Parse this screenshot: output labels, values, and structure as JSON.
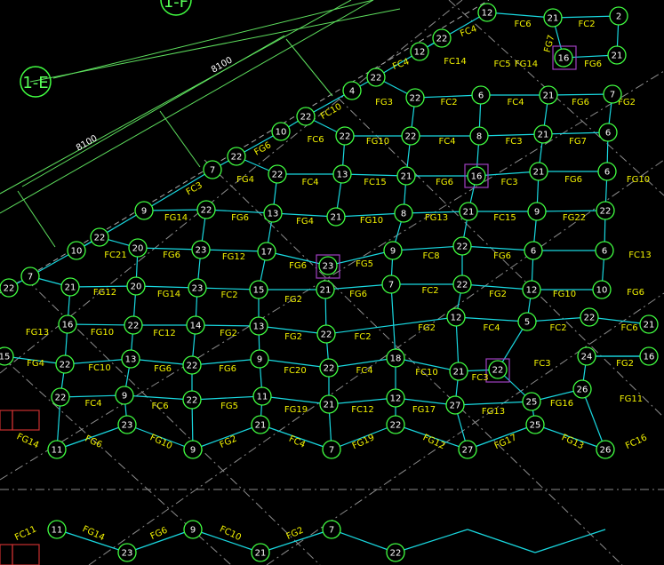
{
  "axis_labels": {
    "axis_e": "1-E",
    "axis_f": "1-F"
  },
  "dimensions": {
    "upper": "8100",
    "lower": "8100"
  },
  "colors": {
    "background": "#000000",
    "node_ring": "#41ff41",
    "beam": "#19d8e0",
    "label": "#f2f200",
    "dimension": "#5ee05e",
    "axis_dash": "#8c8c8c",
    "column_box": "#a040c0",
    "slab_box": "#c83030"
  },
  "nodes": [
    "12",
    "21",
    "2",
    "16",
    "21",
    "22",
    "12",
    "4",
    "22",
    "22",
    "6",
    "21",
    "7",
    "22",
    "10",
    "22",
    "22",
    "8",
    "21",
    "6",
    "22",
    "7",
    "22",
    "13",
    "21",
    "16",
    "21",
    "6",
    "9",
    "22",
    "13",
    "21",
    "8",
    "21",
    "9",
    "22",
    "10",
    "22",
    "20",
    "23",
    "17",
    "23",
    "9",
    "22",
    "6",
    "6",
    "22",
    "7",
    "21",
    "20",
    "23",
    "15",
    "21",
    "7",
    "22",
    "12",
    "10",
    "22",
    "16",
    "22",
    "14",
    "13",
    "22",
    "12",
    "5",
    "21",
    "15",
    "22",
    "13",
    "22",
    "9",
    "22",
    "18",
    "21",
    "22",
    "24",
    "16",
    "22",
    "9",
    "22",
    "11",
    "21",
    "12",
    "27",
    "25",
    "26",
    "11",
    "23",
    "9",
    "21",
    "7",
    "22",
    "27",
    "25",
    "26",
    "11",
    "23",
    "9",
    "21",
    "7",
    "22"
  ],
  "beam_labels": [
    "FC4",
    "FC6",
    "FC2",
    "FG7",
    "FC5",
    "FG14",
    "FG6",
    "FC14",
    "FC4",
    "FG3",
    "FC2",
    "FC4",
    "FG6",
    "FC10",
    "FC6",
    "FG10",
    "FC4",
    "FC3",
    "FG7",
    "FG2",
    "FG6",
    "FG4",
    "FC4",
    "FC15",
    "FG6",
    "FC3",
    "FG6",
    "FG10",
    "FC3",
    "FG14",
    "FG6",
    "FG4",
    "FG10",
    "FG13",
    "FC15",
    "FG22",
    "FC21",
    "FG6",
    "FG12",
    "FG6",
    "FG5",
    "FC8",
    "FG6",
    "FC13",
    "FG12",
    "FG14",
    "FC2",
    "FG2",
    "FG6",
    "FC2",
    "FG2",
    "FG10",
    "FG6",
    "FG13",
    "FG10",
    "FC12",
    "FG2",
    "FG2",
    "FC2",
    "FG2",
    "FC4",
    "FC2",
    "FC6",
    "FG4",
    "FC10",
    "FG6",
    "FG6",
    "FC20",
    "FC4",
    "FC10",
    "FC3",
    "FC3",
    "FG2",
    "FC4",
    "FC6",
    "FG5",
    "FG19",
    "FC12",
    "FG17",
    "FG13",
    "FG16",
    "FG11",
    "FG14",
    "FG6",
    "FG10",
    "FG2",
    "FC4",
    "FG19",
    "FG12",
    "FG17",
    "FG13",
    "FC16",
    "FC11",
    "FG14",
    "FG6",
    "FC10",
    "FG2"
  ]
}
